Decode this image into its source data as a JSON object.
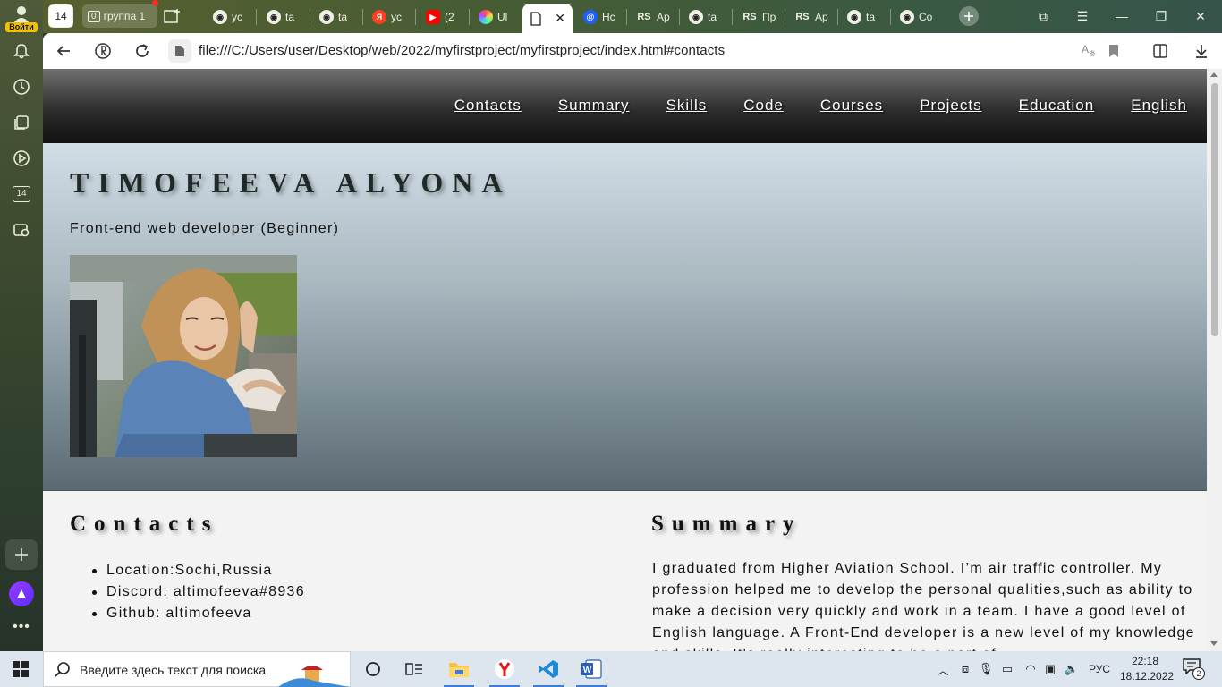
{
  "browser": {
    "profile": {
      "login_label": "Войти"
    },
    "tab_group_count": "14",
    "group": {
      "count": "0",
      "label": "группа 1"
    },
    "tabs": [
      {
        "label": "yc",
        "icon": "github-icon"
      },
      {
        "label": "ta",
        "icon": "github-icon"
      },
      {
        "label": "ta",
        "icon": "github-icon"
      },
      {
        "label": "yc",
        "icon": "yandex-icon"
      },
      {
        "label": "(2",
        "icon": "youtube-icon"
      },
      {
        "label": "Ul",
        "icon": "ui-icon"
      },
      {
        "label": "",
        "icon": "file-icon",
        "active": true
      },
      {
        "label": "Hc",
        "icon": "mail-icon"
      },
      {
        "label": "Ap",
        "icon": "rs-icon"
      },
      {
        "label": "ta",
        "icon": "github-icon"
      },
      {
        "label": "Пр",
        "icon": "rs-icon"
      },
      {
        "label": "Ap",
        "icon": "rs-icon"
      },
      {
        "label": "ta",
        "icon": "github-icon"
      },
      {
        "label": "Co",
        "icon": "github-icon"
      }
    ],
    "url": "file:///C:/Users/user/Desktop/web/2022/myfirstproject/myfirstproject/index.html#contacts",
    "sidebar_badge": "14"
  },
  "page": {
    "nav": [
      "Contacts",
      "Summary",
      "Skills",
      "Code",
      "Courses",
      "Projects",
      "Education",
      "English"
    ],
    "name": "TIMOFEEVA ALYONA",
    "subtitle": "Front-end web developer (Beginner)",
    "contacts": {
      "title": "Contacts",
      "items": [
        "Location:Sochi,Russia",
        "Discord: altimofeeva#8936",
        "Github: altimofeeva"
      ]
    },
    "summary": {
      "title": "Summary",
      "text": "I graduated from Higher Aviation School. I’m air traffic controller. My profession helped me to develop the personal qualities,such as ability to make a decision very quickly and work in a team. I have a good level of English language. A Front-End developer is a new level of my knowledge and skills. It's really interesting to be a part of"
    }
  },
  "taskbar": {
    "search_placeholder": "Введите здесь текст для поиска",
    "language": "РУС",
    "time": "22:18",
    "date": "18.12.2022",
    "notification_count": "2"
  },
  "colors": {
    "accent": "#3b7dd8",
    "header_dark": "#111111",
    "hero_top": "#d2dde6",
    "hero_bottom": "#5b6a72"
  }
}
